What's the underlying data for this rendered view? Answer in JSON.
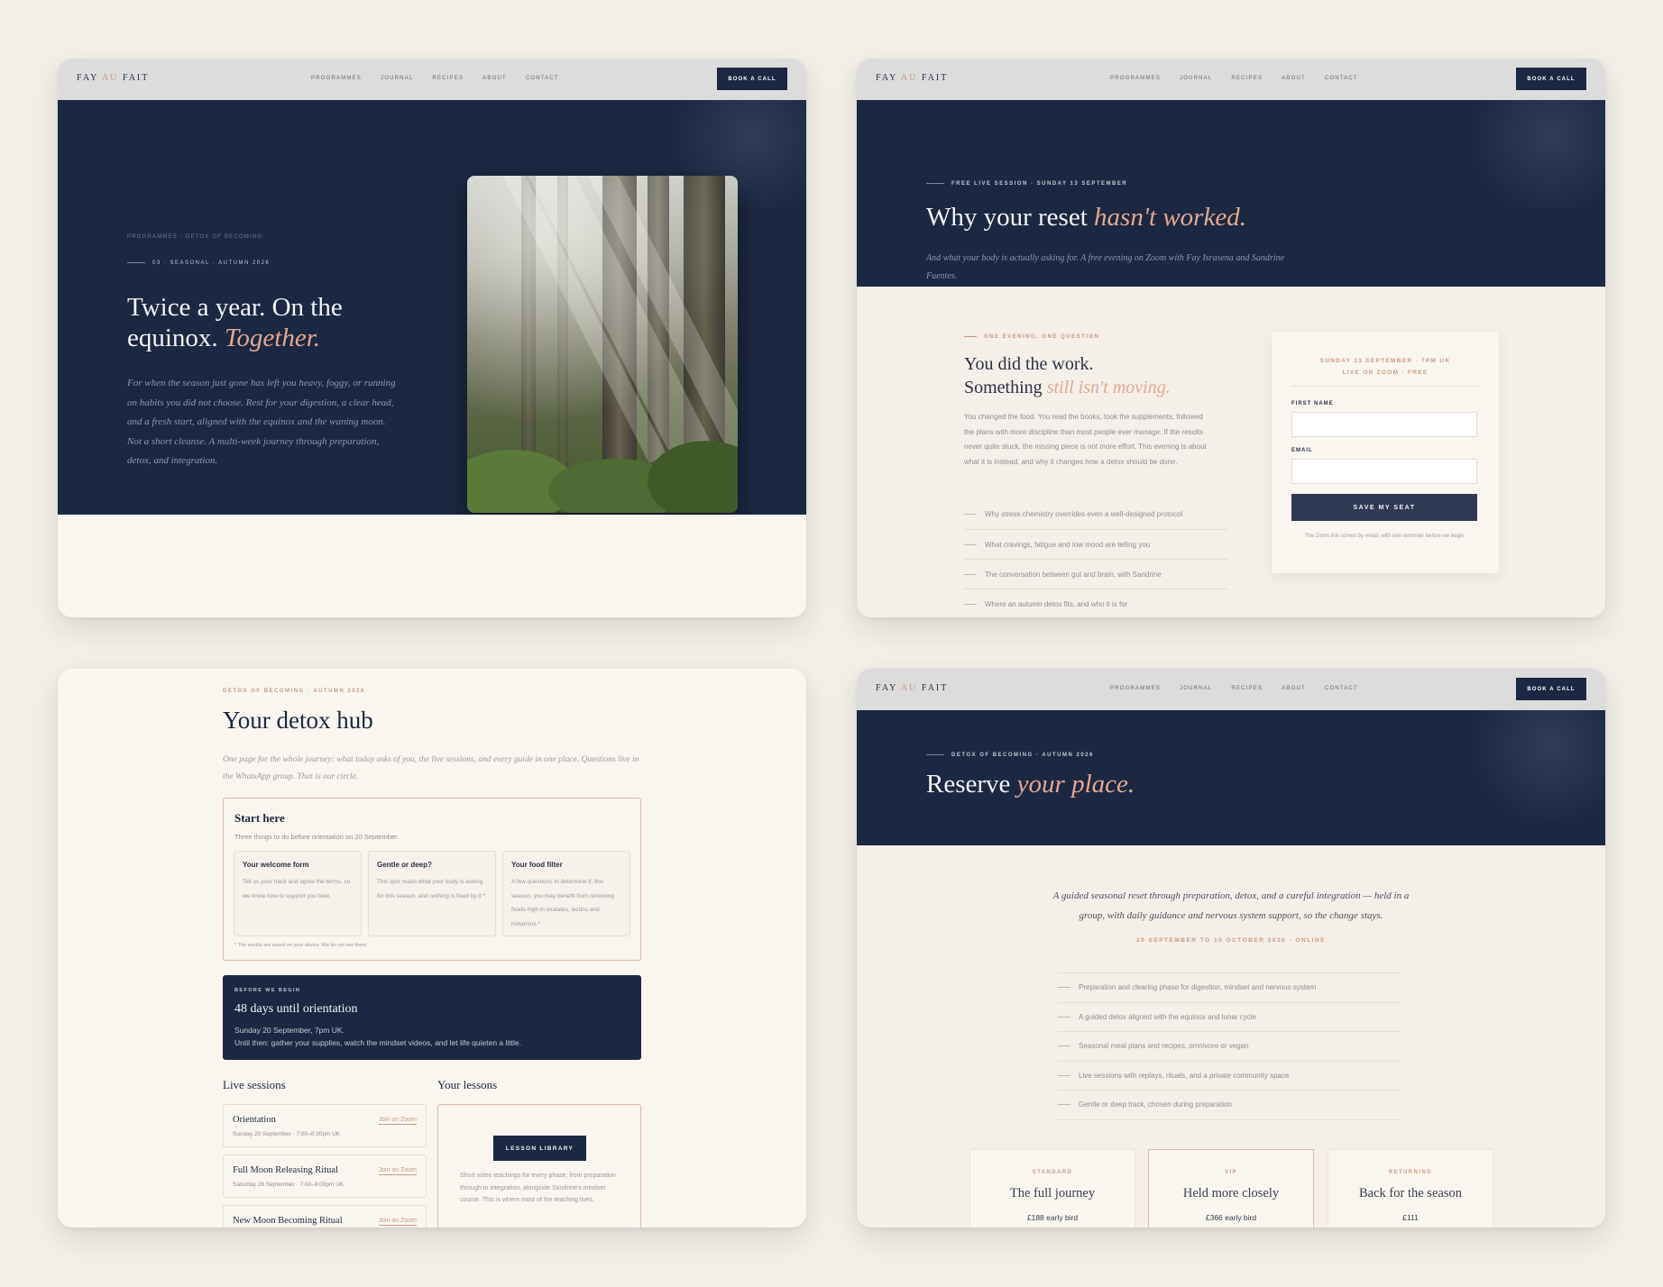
{
  "nav": {
    "logo": {
      "pre": "FAY ",
      "au": "AU",
      "post": " FAIT"
    },
    "links": [
      "PROGRAMMES",
      "JOURNAL",
      "RECIPES",
      "ABOUT",
      "CONTACT"
    ],
    "cta": "BOOK A CALL"
  },
  "programme": {
    "breadcrumb": "PROGRAMMES  ·  DETOX OF BECOMING",
    "eyebrow": "03 · SEASONAL · AUTUMN 2026",
    "title_plain": "Twice a year. On the equinox.",
    "title_accent": "Together.",
    "body": "For when the season just gone has left you heavy, foggy, or running on habits you did not choose. Rest for your digestion, a clear head, and a fresh start, aligned with the equinox and the waning moon. Not a short cleanse. A multi-week journey through preparation, detox, and integration.",
    "image_icon": "forest-photo"
  },
  "live_session": {
    "eyebrow": "FREE LIVE SESSION · SUNDAY 13 SEPTEMBER",
    "title_plain": "Why your reset",
    "title_accent": "hasn't worked.",
    "subtitle": "And what your body is actually asking for. A free evening on Zoom with Fay Israsena and Sandrine Fuentes.",
    "section_eyebrow": "ONE EVENING, ONE QUESTION",
    "heading_line1": "You did the work.",
    "heading_line2_plain": "Something",
    "heading_line2_accent": "still isn't moving.",
    "body": "You changed the food. You read the books, took the supplements, followed the plans with more discipline than most people ever manage. If the results never quite stuck, the missing piece is not more effort. This evening is about what it is instead, and why it changes how a detox should be done.",
    "points": [
      "Why stress chemistry overrides even a well-designed protocol",
      "What cravings, fatigue and low mood are telling you",
      "The conversation between gut and brain, with Sandrine",
      "Where an autumn detox fits, and who it is for"
    ],
    "form": {
      "header_line1": "SUNDAY 13 SEPTEMBER · 7PM UK",
      "header_line2": "LIVE ON ZOOM · FREE",
      "first_name_label": "FIRST NAME",
      "first_name_value": "",
      "email_label": "EMAIL",
      "email_value": "",
      "submit": "SAVE MY SEAT",
      "note": "The Zoom link comes by email, with one reminder before we begin"
    }
  },
  "hub": {
    "eyebrow": "DETOX OF BECOMING · AUTUMN 2026",
    "title": "Your detox hub",
    "subtitle": "One page for the whole journey: what today asks of you, the live sessions, and every guide in one place. Questions live in the WhatsApp group. That is our circle.",
    "start": {
      "title": "Start here",
      "subtitle": "Three things to do before orientation on 20 September.",
      "cards": [
        {
          "title": "Your welcome form",
          "body": "Tell us your track and agree the terms, so we know how to support you best."
        },
        {
          "title": "Gentle or deep?",
          "body": "This quiz reads what your body is asking for this season, and nothing is fixed by it *"
        },
        {
          "title": "Your food filter",
          "body": "A few questions to determine if, this season, you may benefit from removing foods high in oxalates, lectins and histamine *"
        }
      ],
      "footnote": "* The results are saved on your device. We do not see them."
    },
    "orientation": {
      "eyebrow": "BEFORE WE BEGIN",
      "title": "48 days until orientation",
      "line1": "Sunday 20 September, 7pm UK.",
      "line2": "Until then: gather your supplies, watch the mindset videos, and let life quieten a little."
    },
    "live_sessions_heading": "Live sessions",
    "lessons_heading": "Your lessons",
    "sessions": [
      {
        "name": "Orientation",
        "date": "Sunday 20 September · 7:00–8:30pm UK",
        "link": "Join on Zoom"
      },
      {
        "name": "Full Moon Releasing Ritual",
        "date": "Saturday 26 September · 7:00–8:00pm UK",
        "link": "Join on Zoom"
      },
      {
        "name": "New Moon Becoming Ritual",
        "date": "",
        "link": "Join on Zoom"
      }
    ],
    "lessons": {
      "button": "LESSON LIBRARY",
      "body": "Short video teachings for every phase, from preparation through to integration, alongside Sandrine's mindset course. This is where most of the teaching lives."
    }
  },
  "reserve": {
    "eyebrow": "DETOX OF BECOMING · AUTUMN 2026",
    "title_plain": "Reserve",
    "title_accent": "your place.",
    "lead": "A guided seasonal reset through preparation, detox, and a careful integration — held in a group, with daily guidance and nervous system support, so the change stays.",
    "dates": "20 SEPTEMBER TO 10 OCTOBER 2026 · ONLINE",
    "features": [
      "Preparation and clearing phase for digestion, mindset and nervous system",
      "A guided detox aligned with the equinox and lunar cycle",
      "Seasonal meal plans and recipes, omnivore or vegan",
      "Live sessions with replays, rituals, and a private community space",
      "Gentle or deep track, chosen during preparation"
    ],
    "tiers": [
      {
        "eyebrow": "STANDARD",
        "name": "The full journey",
        "price": "£188 early bird"
      },
      {
        "eyebrow": "VIP",
        "name": "Held more closely",
        "price": "£366 early bird"
      },
      {
        "eyebrow": "RETURNING",
        "name": "Back for the season",
        "price": "£111"
      }
    ]
  },
  "colors": {
    "navy": "#1c2841",
    "accent": "#e2a892",
    "cream": "#f9f6f0",
    "background": "#f3efe9",
    "nav_bar": "#dcdcdc"
  }
}
